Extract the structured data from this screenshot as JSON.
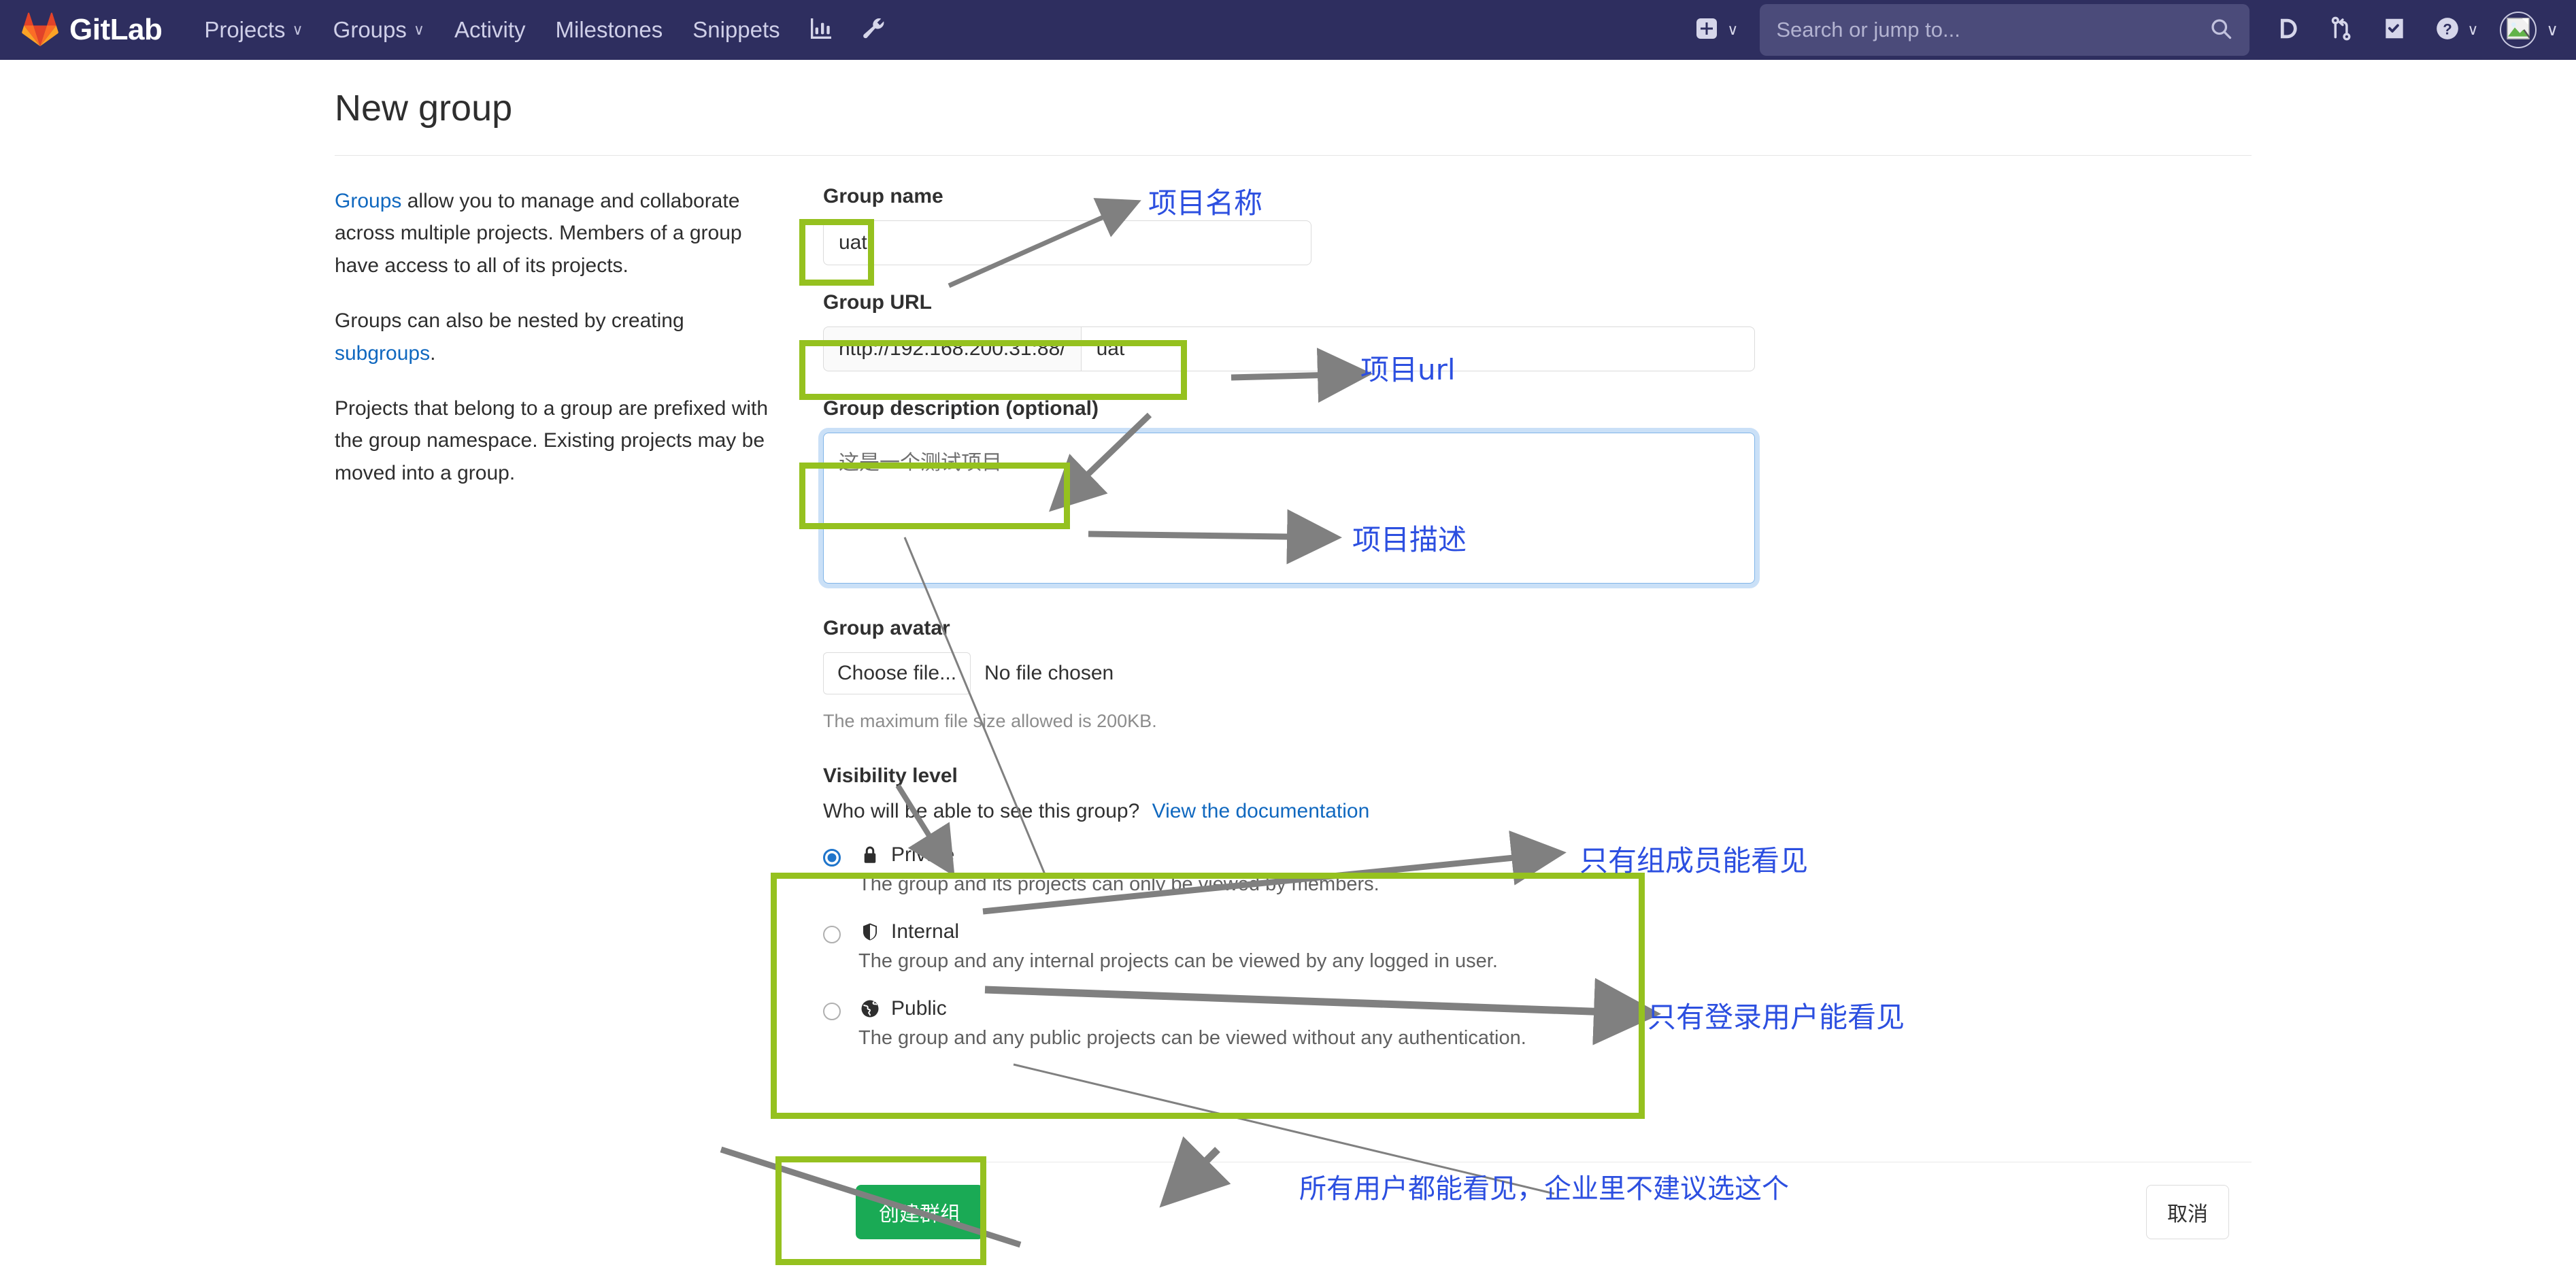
{
  "navbar": {
    "brand": "GitLab",
    "brand_logo_icon": "gitlab-tanuki-logo",
    "links": [
      {
        "label": "Projects",
        "caret": "∨"
      },
      {
        "label": "Groups",
        "caret": "∨"
      },
      {
        "label": "Activity",
        "caret": ""
      },
      {
        "label": "Milestones",
        "caret": ""
      },
      {
        "label": "Snippets",
        "caret": ""
      }
    ],
    "analytics_icon": "bar-chart-icon",
    "admin_icon": "wrench-icon",
    "plus_icon": "plus-square-icon",
    "plus_caret": "∨",
    "search_placeholder": "Search or jump to...",
    "search_value": "",
    "search_icon": "search-icon",
    "issues_icon": "issues-icon",
    "merge_requests_icon": "merge-request-icon",
    "todos_icon": "todo-check-icon",
    "help_icon": "question-circle-icon",
    "help_caret": "∨",
    "avatar_icon": "broken-image-avatar-icon",
    "avatar_caret": "∨"
  },
  "page": {
    "title": "New group"
  },
  "intro": {
    "p1_link": "Groups",
    "p1_rest": " allow you to manage and collaborate across multiple projects. Members of a group have access to all of its projects.",
    "p2_pre": "Groups can also be nested by creating ",
    "p2_link": "subgroups",
    "p2_post": ".",
    "p3": "Projects that belong to a group are prefixed with the group namespace. Existing projects may be moved into a group."
  },
  "form": {
    "group_name_label": "Group name",
    "group_name_value": "uat",
    "group_name_placeholder": "",
    "group_url_label": "Group URL",
    "group_url_prefix": "http://192.168.200.31:88/",
    "group_url_value": "uat",
    "group_desc_label": "Group description (optional)",
    "group_desc_value": "",
    "group_desc_placeholder": "这是一个测试项目",
    "group_avatar_label": "Group avatar",
    "choose_file_label": "Choose file...",
    "no_file_label": "No file chosen",
    "avatar_hint": "The maximum file size allowed is 200KB.",
    "visibility_label": "Visibility level",
    "visibility_question": "Who will be able to see this group?",
    "visibility_doc_link": "View the documentation",
    "visibility_options": [
      {
        "name": "Private",
        "icon": "lock-icon",
        "desc": "The group and its projects can only be viewed by members.",
        "selected": true
      },
      {
        "name": "Internal",
        "icon": "shield-icon",
        "desc": "The group and any internal projects can be viewed by any logged in user.",
        "selected": false
      },
      {
        "name": "Public",
        "icon": "globe-icon",
        "desc": "The group and any public projects can be viewed without any authentication.",
        "selected": false
      }
    ],
    "create_button": "创建群组",
    "cancel_button": "取消"
  },
  "annotations": {
    "highlight_color": "#95c11f",
    "text_color": "#2c4fe0",
    "arrow_color": "#808080",
    "labels": {
      "group_name": "项目名称",
      "group_url": "项目url",
      "group_desc": "项目描述",
      "private": "只有组成员能看见",
      "internal": "只有登录用户能看见",
      "public": "所有用户都能看见，企业里不建议选这个"
    }
  }
}
